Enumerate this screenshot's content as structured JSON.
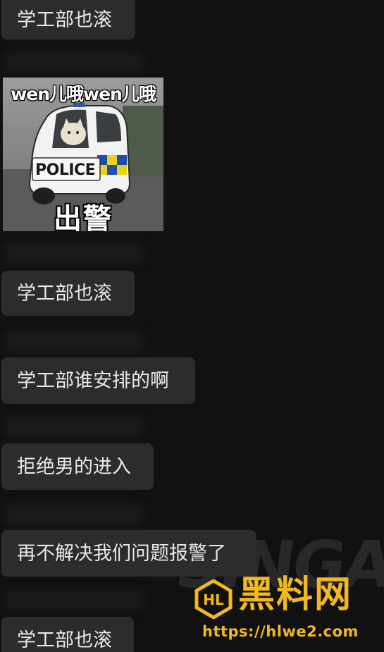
{
  "messages": [
    {
      "text": "学工部也滚"
    },
    {
      "text": "学工部也滚"
    },
    {
      "text": "学工部谁安排的啊"
    },
    {
      "text": "拒绝男的进入"
    },
    {
      "text": "再不解决我们问题报警了"
    },
    {
      "text": "学工部也滚"
    }
  ],
  "sticker": {
    "top_caption": "wen儿哦wen儿哦",
    "car_text": "POLICE",
    "bottom_caption": "出警"
  },
  "watermark": {
    "background_text": "SINGA",
    "title": "黑料网",
    "url": "https://hlwe2.com",
    "brand_color": "#f1b820"
  },
  "theme": {
    "background": "#111112",
    "bubble": "#2c2c2e",
    "text": "#e9e9e9"
  }
}
